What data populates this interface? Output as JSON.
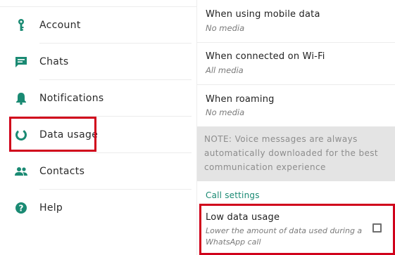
{
  "colors": {
    "accent": "#128c7e",
    "highlight": "#d0021b"
  },
  "menu": {
    "items": [
      {
        "label": "Account",
        "icon": "key-icon"
      },
      {
        "label": "Chats",
        "icon": "chat-icon"
      },
      {
        "label": "Notifications",
        "icon": "bell-icon"
      },
      {
        "label": "Data usage",
        "icon": "data-usage-icon"
      },
      {
        "label": "Contacts",
        "icon": "contacts-icon"
      },
      {
        "label": "Help",
        "icon": "help-icon"
      }
    ]
  },
  "settings": {
    "mobile_data": {
      "title": "When using mobile data",
      "value": "No media"
    },
    "wifi": {
      "title": "When connected on Wi-Fi",
      "value": "All media"
    },
    "roaming": {
      "title": "When roaming",
      "value": "No media"
    },
    "note": "NOTE: Voice messages are always automatically downloaded for the best communication experience",
    "call_settings_header": "Call settings",
    "low_data": {
      "title": "Low data usage",
      "description": "Lower the amount of data used during a WhatsApp call",
      "checked": false
    }
  }
}
